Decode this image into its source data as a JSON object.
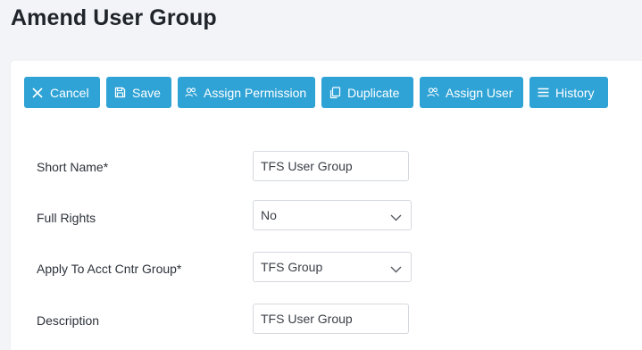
{
  "page": {
    "title": "Amend User Group"
  },
  "toolbar": {
    "cancel_label": "Cancel",
    "save_label": "Save",
    "assign_permission_label": "Assign Permission",
    "duplicate_label": "Duplicate",
    "assign_user_label": "Assign User",
    "history_label": "History",
    "button_color": "#2fa3d6"
  },
  "form": {
    "short_name": {
      "label": "Short Name*",
      "value": "TFS User Group"
    },
    "full_rights": {
      "label": "Full Rights",
      "value": "No"
    },
    "apply_to_acct_cntr_group": {
      "label": "Apply To Acct Cntr Group*",
      "value": "TFS Group"
    },
    "description": {
      "label": "Description",
      "value": "TFS User Group"
    }
  }
}
